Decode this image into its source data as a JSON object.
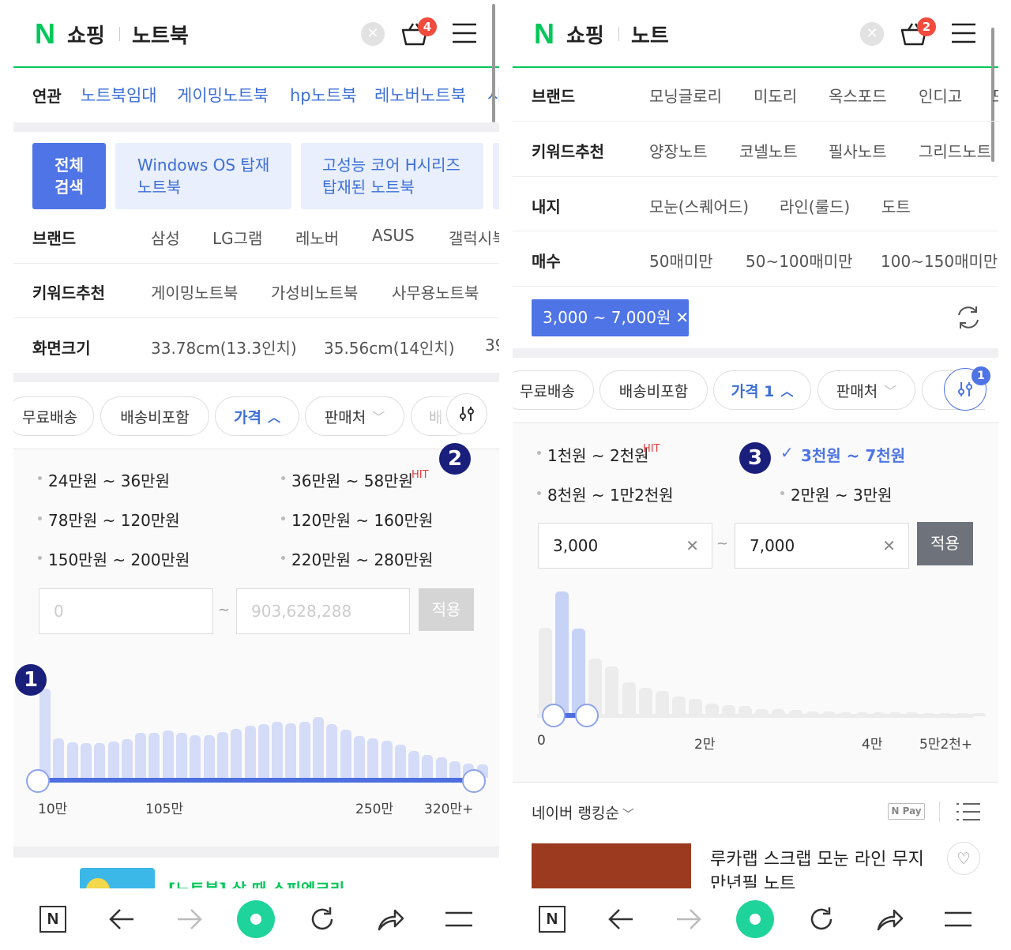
{
  "left": {
    "logo": "N",
    "app": "쇼핑",
    "query": "노트북",
    "cart_count": "4",
    "related_label": "연관",
    "related": [
      "노트북임대",
      "게이밍노트북",
      "hp노트북",
      "레노버노트북",
      "시"
    ],
    "chips": [
      {
        "line1": "전체",
        "line2": "검색"
      },
      {
        "line1": "Windows OS 탑재",
        "line2": "노트북"
      },
      {
        "line1": "고성능 코어 H시리즈",
        "line2": "탑재된 노트북"
      }
    ],
    "filters": [
      {
        "label": "브랜드",
        "values": [
          "삼성",
          "LG그램",
          "레노버",
          "ASUS",
          "갤럭시북"
        ]
      },
      {
        "label": "키워드추천",
        "values": [
          "게이밍노트북",
          "가성비노트북",
          "사무용노트북"
        ]
      },
      {
        "label": "화면크기",
        "values": [
          "33.78cm(13.3인치)",
          "35.56cm(14인치)",
          "39"
        ]
      }
    ],
    "tabs": [
      "무료배송",
      "배송비포함",
      "가격",
      "판매처",
      "배"
    ],
    "price_options": [
      "24만원 ~ 36만원",
      "36만원 ~ 58만원",
      "78만원 ~ 120만원",
      "120만원 ~ 160만원",
      "150만원 ~ 200만원",
      "220만원 ~ 280만원"
    ],
    "hit": "HIT",
    "min_placeholder": "0",
    "max_placeholder": "903,628,288",
    "apply": "적용",
    "hist": [
      1.0,
      0.44,
      0.4,
      0.39,
      0.39,
      0.41,
      0.43,
      0.5,
      0.5,
      0.53,
      0.5,
      0.48,
      0.48,
      0.51,
      0.55,
      0.58,
      0.6,
      0.63,
      0.61,
      0.63,
      0.68,
      0.6,
      0.54,
      0.47,
      0.44,
      0.42,
      0.37,
      0.3,
      0.26,
      0.23,
      0.19,
      0.16,
      0.15
    ],
    "range_selected": [
      0,
      1
    ],
    "axis": [
      "10만",
      "105만",
      "250만",
      "320만+"
    ],
    "promo": "[노트북] 살 때 스피엑크리",
    "badges": [
      "1",
      "2"
    ]
  },
  "right": {
    "logo": "N",
    "app": "쇼핑",
    "query": "노트",
    "cart_count": "2",
    "filters": [
      {
        "label": "브랜드",
        "values": [
          "모닝글로리",
          "미도리",
          "옥스포드",
          "인디고",
          "모"
        ]
      },
      {
        "label": "키워드추천",
        "values": [
          "양장노트",
          "코넬노트",
          "필사노트",
          "그리드노트"
        ]
      },
      {
        "label": "내지",
        "values": [
          "모눈(스퀘어드)",
          "라인(룰드)",
          "도트"
        ]
      },
      {
        "label": "매수",
        "values": [
          "50매미만",
          "50~100매미만",
          "100~150매미만"
        ]
      }
    ],
    "active_filter": "3,000 ~ 7,000원",
    "tabs": [
      "무료배송",
      "배송비포함",
      "가격 1",
      "판매처"
    ],
    "filter_count": "1",
    "price_options": [
      "1천원 ~ 2천원",
      "3천원 ~ 7천원",
      "8천원 ~ 1만2천원",
      "2만원 ~ 3만원"
    ],
    "hit": "HIT",
    "min_value": "3,000",
    "max_value": "7,000",
    "apply": "적용",
    "hist": [
      0.71,
      1.0,
      0.7,
      0.46,
      0.4,
      0.27,
      0.23,
      0.2,
      0.16,
      0.14,
      0.1,
      0.09,
      0.08,
      0.06,
      0.06,
      0.05,
      0.04,
      0.04,
      0.03,
      0.03,
      0.03,
      0.03,
      0.03,
      0.02,
      0.02,
      0.02,
      0.02
    ],
    "range_selected": [
      1,
      2
    ],
    "axis": [
      "0",
      "2만",
      "4만",
      "5만2천+"
    ],
    "sort": "네이버 랭킹순",
    "npay": "N Pay",
    "product_title": [
      "루카랩 스크랩 모눈 라인 무지",
      "만년필 노트"
    ],
    "badges": [
      "3"
    ]
  },
  "colors": {
    "green": "#03c75a",
    "blue": "#4e74e6",
    "chip_bg": "#e9effc",
    "link": "#3d6fd6",
    "hit": "#e63d3d",
    "badge": "#1a1f7c",
    "bar": "#d4dcf8",
    "bar_right": "#ececec",
    "bar_sel": "#c6d2f6"
  }
}
